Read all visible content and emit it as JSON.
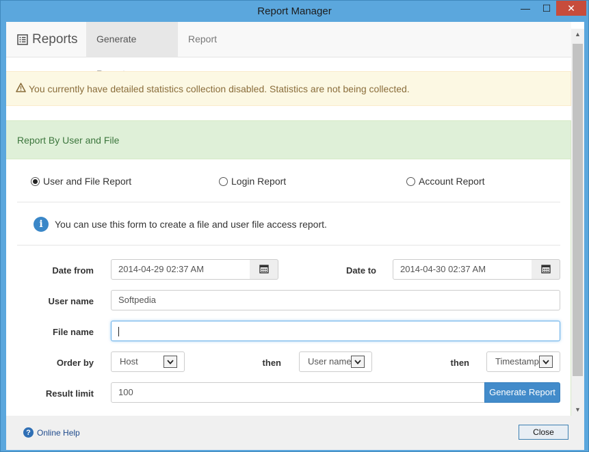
{
  "window": {
    "title": "Report Manager",
    "min_glyph": "—",
    "max_glyph": "☐",
    "close_glyph": "✕"
  },
  "nav": {
    "brand": "Reports",
    "tabs": [
      {
        "label": "Generate Report"
      },
      {
        "label": "Report"
      }
    ],
    "active_tab": "Generate Report"
  },
  "alert": {
    "text": "You currently have detailed statistics collection disabled. Statistics are not being collected."
  },
  "panel": {
    "heading": "Report By User and File",
    "report_types": [
      {
        "label": "User and File Report",
        "selected": true
      },
      {
        "label": "Login Report",
        "selected": false
      },
      {
        "label": "Account Report",
        "selected": false
      }
    ],
    "info": "You can use this form to create a file and user file access report."
  },
  "form": {
    "date_from_label": "Date from",
    "date_from_value": "2014-04-29 02:37 AM",
    "date_to_label": "Date to",
    "date_to_value": "2014-04-30 02:37 AM",
    "user_name_label": "User name",
    "user_name_value": "Softpedia",
    "file_name_label": "File name",
    "file_name_value": "",
    "order_by_label": "Order by",
    "order_by_value": "Host",
    "then_label": "then",
    "then1_value": "User name",
    "then2_value": "Timestamp",
    "result_limit_label": "Result limit",
    "result_limit_value": "100",
    "generate_label": "Generate Report"
  },
  "footer": {
    "help_label": "Online Help",
    "close_label": "Close"
  },
  "colors": {
    "titlebar": "#5ba7dd",
    "alert_bg": "#fcf8e3",
    "panel_heading_bg": "#dff0d8",
    "primary": "#428bca"
  }
}
